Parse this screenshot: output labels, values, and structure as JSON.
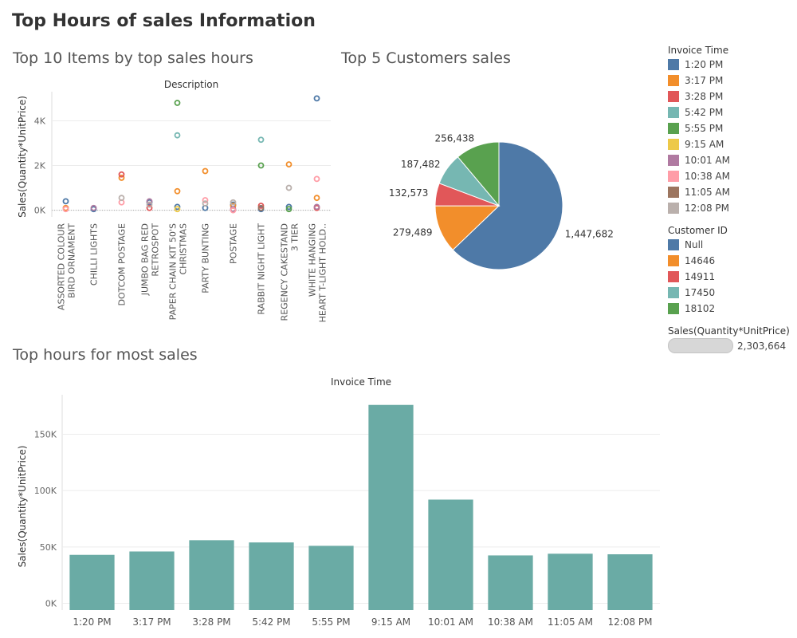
{
  "dashboard_title": "Top Hours of sales Information",
  "colors": {
    "1:20 PM": "#4e79a7",
    "3:17 PM": "#f28e2b",
    "3:28 PM": "#e15759",
    "5:42 PM": "#76b7b2",
    "5:55 PM": "#59a14f",
    "9:15 AM": "#edc948",
    "10:01 AM": "#b07aa1",
    "10:38 AM": "#ff9da7",
    "11:05 AM": "#9c755f",
    "12:08 PM": "#bab0ac",
    "Null": "#4e79a7",
    "14646": "#f28e2b",
    "14911": "#e15759",
    "17450": "#76b7b2",
    "18102": "#59a14f",
    "bar": "#6aaba5",
    "gridline": "#ececec"
  },
  "legends": {
    "invoice_time": {
      "title": "Invoice Time",
      "items": [
        "1:20 PM",
        "3:17 PM",
        "3:28 PM",
        "5:42 PM",
        "5:55 PM",
        "9:15 AM",
        "10:01 AM",
        "10:38 AM",
        "11:05 AM",
        "12:08 PM"
      ]
    },
    "customer_id": {
      "title": "Customer ID",
      "items": [
        "Null",
        "14646",
        "14911",
        "17450",
        "18102"
      ]
    },
    "size": {
      "title": "Sales(Quantity*UnitPrice)",
      "value": "2,303,664"
    }
  },
  "chart_data": [
    {
      "type": "scatter",
      "title": "Top 10 Items by top sales hours",
      "xlabel": "Description",
      "ylabel": "Sales(Quantity*UnitPrice)",
      "ylim": [
        -300,
        5300
      ],
      "yticks": [
        0,
        2000,
        4000
      ],
      "ytick_labels": [
        "0K",
        "2K",
        "4K"
      ],
      "grid": true,
      "categories": [
        [
          "ASSORTED COLOUR",
          "BIRD ORNAMENT"
        ],
        [
          "CHILLI LIGHTS"
        ],
        [
          "DOTCOM POSTAGE"
        ],
        [
          "JUMBO BAG RED",
          "RETROSPOT"
        ],
        [
          "PAPER CHAIN KIT 50'S",
          "CHRISTMAS"
        ],
        [
          "PARTY BUNTING"
        ],
        [
          "POSTAGE"
        ],
        [
          "RABBIT NIGHT LIGHT"
        ],
        [
          "REGENCY CAKESTAND",
          "3 TIER"
        ],
        [
          "WHITE HANGING",
          "HEART T-LIGHT HOLD.."
        ]
      ],
      "series": [
        {
          "name": "1:20 PM",
          "values": [
            400,
            50,
            null,
            350,
            150,
            100,
            250,
            50,
            150,
            5000
          ]
        },
        {
          "name": "3:17 PM",
          "values": [
            100,
            null,
            1450,
            null,
            850,
            1750,
            200,
            null,
            2050,
            550
          ]
        },
        {
          "name": "3:28 PM",
          "values": [
            null,
            null,
            1600,
            100,
            null,
            null,
            null,
            200,
            null,
            100
          ]
        },
        {
          "name": "5:42 PM",
          "values": [
            null,
            null,
            null,
            null,
            3350,
            null,
            null,
            3150,
            null,
            null
          ]
        },
        {
          "name": "5:55 PM",
          "values": [
            null,
            null,
            null,
            null,
            4800,
            null,
            null,
            2000,
            50,
            null
          ]
        },
        {
          "name": "9:15 AM",
          "values": [
            null,
            null,
            null,
            null,
            50,
            null,
            null,
            null,
            null,
            null
          ]
        },
        {
          "name": "10:01 AM",
          "values": [
            null,
            100,
            null,
            400,
            null,
            null,
            50,
            null,
            null,
            150
          ]
        },
        {
          "name": "10:38 AM",
          "values": [
            50,
            null,
            350,
            null,
            null,
            450,
            0,
            null,
            null,
            1400
          ]
        },
        {
          "name": "11:05 AM",
          "values": [
            null,
            null,
            null,
            null,
            null,
            null,
            null,
            100,
            null,
            null
          ]
        },
        {
          "name": "12:08 PM",
          "values": [
            null,
            null,
            550,
            250,
            null,
            300,
            350,
            null,
            1000,
            null
          ]
        }
      ]
    },
    {
      "type": "pie",
      "title": "Top 5 Customers sales",
      "categories": [
        "Null",
        "14646",
        "14911",
        "17450",
        "18102"
      ],
      "values": [
        1447682,
        279489,
        132573,
        187482,
        256438
      ],
      "labels": [
        "1,447,682",
        "279,489",
        "132,573",
        "187,482",
        "256,438"
      ]
    },
    {
      "type": "bar",
      "title": "Top hours for most sales",
      "xlabel": "Invoice Time",
      "ylabel": "Sales(Quantity*UnitPrice)",
      "categories": [
        "1:20 PM",
        "3:17 PM",
        "3:28 PM",
        "5:42 PM",
        "5:55 PM",
        "9:15 AM",
        "10:01 AM",
        "10:38 AM",
        "11:05 AM",
        "12:08 PM"
      ],
      "values": [
        43000,
        46000,
        56000,
        54000,
        51000,
        176000,
        92000,
        42500,
        44000,
        43500
      ],
      "ylim": [
        -6000,
        185000
      ],
      "yticks": [
        0,
        50000,
        100000,
        150000
      ],
      "ytick_labels": [
        "0K",
        "50K",
        "100K",
        "150K"
      ],
      "grid": true
    }
  ]
}
